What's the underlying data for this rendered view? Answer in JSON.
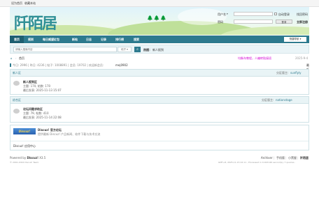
{
  "topbar": {
    "set_home": "设为首页",
    "bookmark": "收藏本站"
  },
  "header": {
    "logo_text": "阡陌居",
    "username_label": "用户名",
    "username_select": "▾",
    "autologin_label": "自动登录",
    "forgot_password": "找回密码",
    "password_label": "密码",
    "login_button": "登录",
    "register_link": "立即注册"
  },
  "nav": {
    "items": [
      "首页",
      "规则",
      "每日威望红包",
      "新帖",
      "日志",
      "记录",
      "排行榜",
      "搜索"
    ],
    "quick_nav": "快捷导航 ▾"
  },
  "search": {
    "placeholder": "请输入搜索内容",
    "scope": "帖子 ▾",
    "hot_label": "热搜：",
    "hot_value": "新人报到"
  },
  "breadcrumb": {
    "home_icon": "⌂",
    "current": "首页",
    "notice": "均衡车教程，人编转贴接班",
    "date": "2025-9-4"
  },
  "stats": {
    "text": "今日: 2996 | 昨日: 4236 | 帖子: 1008891 | 会员: 19702 | 欢迎新会员: ",
    "new_member": "mej0902",
    "latest_reply": "最新回复"
  },
  "categories": [
    {
      "name": "新人区",
      "moderator_label": "分区版主:",
      "moderator": "sunflyly",
      "forum": {
        "name": "新人报到区",
        "stats": "主题: 170, 帖数: 170",
        "last": "最后发表: 2025-11-13 15:07"
      }
    },
    {
      "name": "综合区",
      "moderator_label": "分区版主:",
      "moderator": "nationstage",
      "forum": {
        "name": "论坛问题求助区",
        "stats": "主题: 79, 帖数: 410",
        "last": "最后发表: 2025-11-14 22:08"
      }
    }
  ],
  "links": {
    "discuz_name": "Discuz! 官方论坛",
    "discuz_desc": "提供最新 Discuz! 产品新闻、软件下载与技术交流",
    "discuz_badge": "Discuz!",
    "app_center": "Discuz! 应用中心"
  },
  "footer": {
    "powered_by": "Powered by ",
    "powered_name": "Discuz!",
    "powered_version": " X3.5",
    "copyright": "© 2001-2024 Discuz! Team.",
    "archive": "Archiver",
    "mobile": "手机版",
    "blackroom": "小黑屋",
    "brand": "阡陌居",
    "timing": "GMT+8, 2025-11-15 22:11 , Processed in 0.043146 second(s), 7 queries ."
  },
  "colors": {
    "nav": "#2d7a8e",
    "accent": "#2d7a8e",
    "notice": "#d400d4"
  }
}
